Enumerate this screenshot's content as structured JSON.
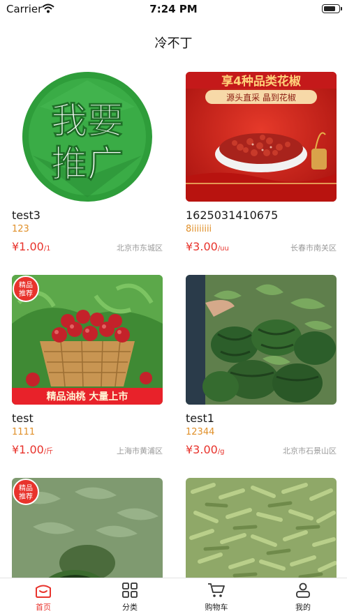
{
  "status_bar": {
    "carrier": "Carrier",
    "time": "7:24 PM"
  },
  "nav": {
    "title": "冷不丁"
  },
  "products": [
    {
      "name": "test3",
      "desc": "123",
      "price": "¥1.00",
      "unit": "/1",
      "location": "北京市东城区",
      "image": {
        "kind": "promo-badge",
        "text1": "我要",
        "text2": "推广"
      }
    },
    {
      "name": "1625031410675",
      "desc": "8iiiiiiii",
      "price": "¥3.00",
      "unit": "/uu",
      "location": "长春市南关区",
      "image": {
        "kind": "pepper-banner",
        "banner": "享4种品类花椒",
        "sub": "源头直采  晶到花椒"
      }
    },
    {
      "name": "test",
      "desc": "1111",
      "price": "¥1.00",
      "unit": "/斤",
      "location": "上海市黄浦区",
      "image": {
        "kind": "peach-basket",
        "badge1": "精品",
        "badge2": "推荐",
        "caption": "精品油桃  大量上市"
      }
    },
    {
      "name": "test1",
      "desc": "12344",
      "price": "¥3.00",
      "unit": "/g",
      "location": "北京市石景山区",
      "image": {
        "kind": "watermelon-pile"
      }
    },
    {
      "name": "",
      "desc": "",
      "price": "",
      "unit": "",
      "location": "",
      "image": {
        "kind": "watermelon-field",
        "badge1": "精品",
        "badge2": "推荐"
      }
    },
    {
      "name": "",
      "desc": "",
      "price": "",
      "unit": "",
      "location": "",
      "image": {
        "kind": "edamame"
      }
    }
  ],
  "tabbar": [
    {
      "label": "首页",
      "icon": "home-icon",
      "active": true
    },
    {
      "label": "分类",
      "icon": "grid-icon",
      "active": false
    },
    {
      "label": "购物车",
      "icon": "cart-icon",
      "active": false
    },
    {
      "label": "我的",
      "icon": "user-icon",
      "active": false
    }
  ],
  "colors": {
    "accent": "#e8332c",
    "desc": "#e0902a",
    "location": "#9a9a9a"
  }
}
